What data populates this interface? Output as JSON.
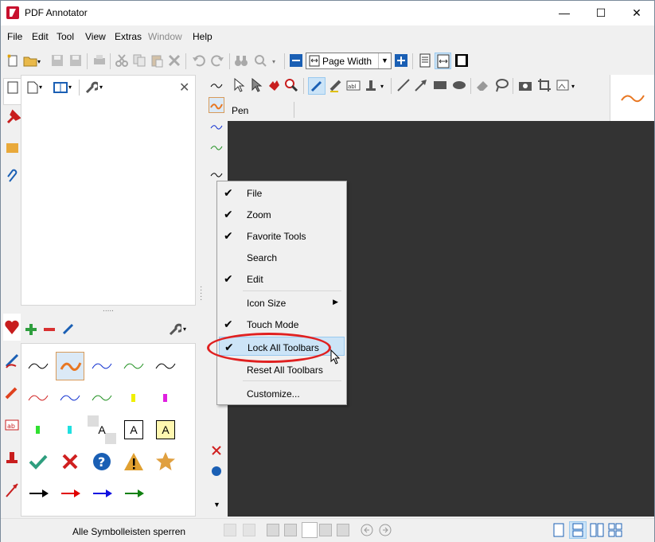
{
  "window": {
    "title": "PDF Annotator",
    "minimize": "—",
    "maximize": "☐",
    "close": "✕"
  },
  "menu": [
    "File",
    "Edit",
    "Tool",
    "View",
    "Extras",
    "Window",
    "Help"
  ],
  "toolbar": {
    "zoom_value": "Page Width"
  },
  "annotation": {
    "property_label": "Pen"
  },
  "context_menu": {
    "items": [
      {
        "label": "File",
        "checked": true
      },
      {
        "label": "Zoom",
        "checked": true
      },
      {
        "label": "Favorite Tools",
        "checked": true
      },
      {
        "label": "Search",
        "checked": false
      },
      {
        "label": "Edit",
        "checked": true
      },
      {
        "label": "Icon Size",
        "checked": false,
        "submenu": true
      },
      {
        "label": "Touch Mode",
        "checked": true
      },
      {
        "label": "Lock All Toolbars",
        "checked": true,
        "highlighted": true
      },
      {
        "label": "Reset All Toolbars",
        "checked": false
      },
      {
        "label": "Customize...",
        "checked": false
      }
    ]
  },
  "statusbar": {
    "text": "Alle Symbolleisten sperren"
  },
  "favorites": {
    "letter": "A"
  },
  "colors": {
    "accent": "#e87722",
    "highlight": "#cce4f7",
    "ring": "#e02020",
    "doc_bg": "#333333"
  }
}
